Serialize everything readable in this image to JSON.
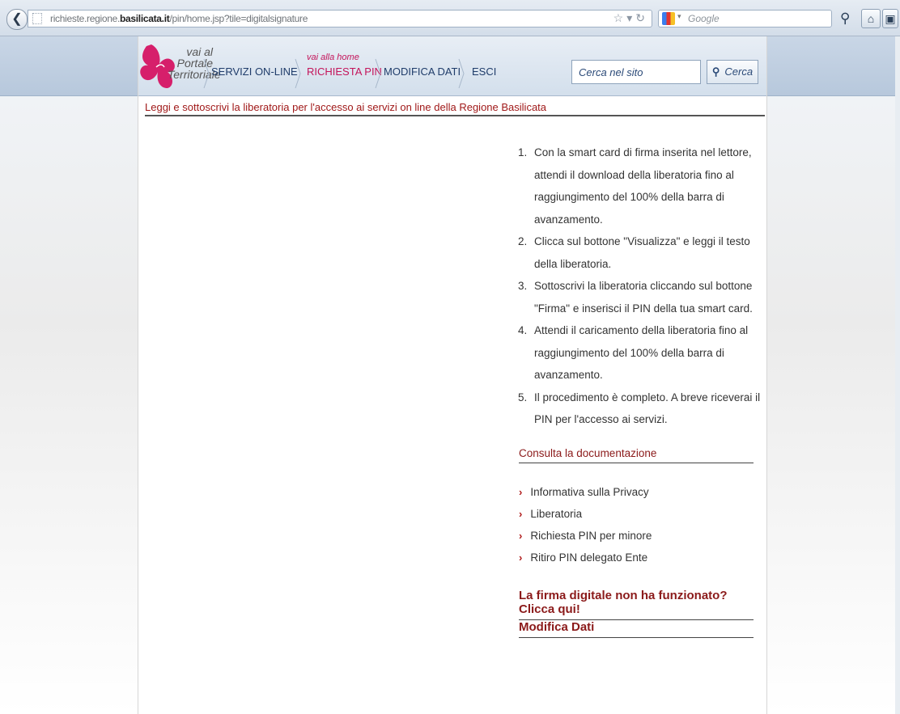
{
  "browser": {
    "url_prefix": "richieste.regione.",
    "url_domain": "basilicata.it",
    "url_path": "/pin/home.jsp?tile=digitalsignature",
    "search_engine_placeholder": "Google"
  },
  "nav": {
    "logo_line1": "vai al",
    "logo_line2": "Portale",
    "logo_line3": "Territoriale",
    "home_hint": "vai alla home",
    "items": [
      {
        "label": "SERVIZI ON-LINE"
      },
      {
        "label": "RICHIESTA PIN"
      },
      {
        "label": "MODIFICA DATI"
      },
      {
        "label": "ESCI"
      }
    ],
    "search_placeholder": "Cerca nel sito",
    "search_button": "Cerca"
  },
  "page_title": "Leggi e sottoscrivi la liberatoria per l'accesso ai servizi on line della Regione Basilicata",
  "instructions": [
    {
      "num": "1.",
      "text": "Con la smart card di firma inserita nel lettore, attendi il download della liberatoria fino al raggiungimento del 100% della barra di avanzamento."
    },
    {
      "num": "2.",
      "text": "Clicca sul bottone \"Visualizza\" e leggi il testo della liberatoria."
    },
    {
      "num": "3.",
      "text": "Sottoscrivi la liberatoria cliccando sul bottone \"Firma\" e inserisci il PIN della tua smart card."
    },
    {
      "num": "4.",
      "text": "Attendi il caricamento della liberatoria fino al raggiungimento del 100% della barra di avanzamento."
    },
    {
      "num": "5.",
      "text": "Il procedimento è completo. A breve riceverai il PIN per l'accesso ai servizi."
    }
  ],
  "docs": {
    "title": "Consulta la documentazione",
    "links": [
      {
        "label": "Informativa sulla Privacy"
      },
      {
        "label": "Liberatoria"
      },
      {
        "label": "Richiesta PIN per minore"
      },
      {
        "label": "Ritiro PIN delegato Ente"
      }
    ]
  },
  "firma_help": "La firma digitale non ha funzionato? Clicca qui!",
  "modifica_dati": "Modifica Dati"
}
